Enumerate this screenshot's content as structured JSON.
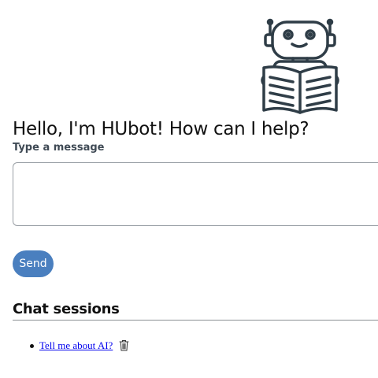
{
  "header": {
    "robot_icon": "robot-reading-book-icon",
    "greeting": "Hello, I'm HUbot! How can I help?"
  },
  "composer": {
    "label": "Type a message",
    "value": "",
    "send_label": "Send",
    "send_color": "#4a7fbf"
  },
  "sessions": {
    "heading": "Chat sessions",
    "items": [
      {
        "title": "Tell me about AI?",
        "delete_icon": "trash-icon"
      }
    ]
  }
}
